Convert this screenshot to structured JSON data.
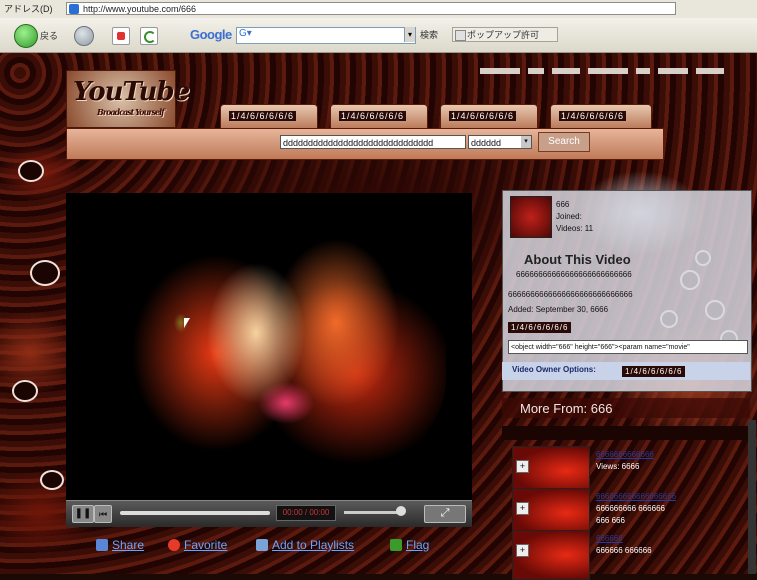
{
  "browser": {
    "address_label": "アドレス(D)",
    "url": "http://www.youtube.com/666",
    "back_label": "戻る",
    "google_label": "Google",
    "google_field": "G▾",
    "search_button": "検索",
    "popup_button": "ポップアップ許可"
  },
  "site": {
    "logo": "YouTube",
    "logo_tagline": "Broadcast Yourself",
    "tabs": [
      "1/4/6/6/6/6/6",
      "1/4/6/6/6/6/6",
      "1/4/6/6/6/6/6",
      "1/4/6/6/6/6/6"
    ],
    "search_value": "dddddddddddddddddddddddddddddd",
    "search_select": "dddddd",
    "search_button": "Search"
  },
  "player": {
    "time": "00:00 / 00:00"
  },
  "actions": {
    "share": "Share",
    "favorite": "Favorite",
    "add_playlist": "Add to Playlists",
    "flag": "Flag"
  },
  "about": {
    "owner_name": "666",
    "owner_joined": "Joined: ",
    "owner_videos": "Videos: 11",
    "title": "About This Video",
    "desc": "66666666666666666666666666",
    "desc2": "6666666666666666666666666666",
    "added": "Added: September 30, 6666",
    "tag": "1/4/6/6/6/6/6",
    "embed": "<object width=\"666\" height=\"666\"><param name=\"movie\"",
    "owner_options_label": "Video Owner Options:",
    "owner_options_tag": "1/4/6/6/6/6/6"
  },
  "more_from": {
    "title": "More From: 666",
    "items": [
      {
        "title": "6666666666666",
        "meta": "Views: 6666",
        "meta2": ""
      },
      {
        "title": "666666666666666666",
        "meta": "666666666 666666",
        "meta2": "666 666"
      },
      {
        "title": "666666",
        "meta": "666666 666666",
        "meta2": ""
      }
    ]
  },
  "colors": {
    "link": "#6aa4ff",
    "accent": "#c07a58"
  }
}
